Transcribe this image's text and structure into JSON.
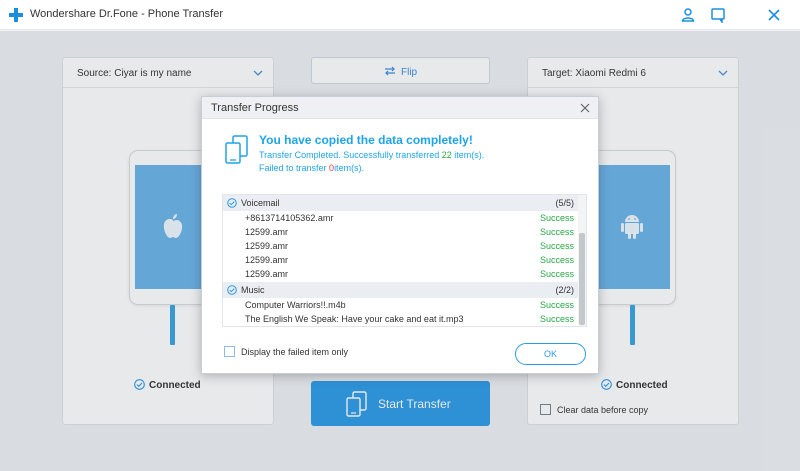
{
  "window": {
    "title": "Wondershare Dr.Fone - Phone Transfer",
    "icons": [
      "account-icon",
      "feedback-icon",
      "close-icon"
    ]
  },
  "source": {
    "label": "Source: Ciyar is my name",
    "status": "Connected",
    "device_icon": "apple-icon"
  },
  "target": {
    "label": "Target: Xiaomi Redmi 6",
    "status": "Connected",
    "device_icon": "android-icon"
  },
  "flip_label": "Flip",
  "start_transfer_label": "Start Transfer",
  "clear_data_label": "Clear data before copy",
  "dialog": {
    "title": "Transfer Progress",
    "summary_title": "You have copied the data completely!",
    "line1_prefix": "Transfer Completed.  Successfully transferred",
    "transferred_count": "22",
    "line1_suffix": "item(s).",
    "line2_prefix": "Failed to transfer",
    "failed_count": "0",
    "line2_suffix": "item(s).",
    "categories": [
      {
        "name": "Voicemail",
        "count": "(5/5)",
        "items": [
          {
            "file": "+8613714105362.amr",
            "status": "Success"
          },
          {
            "file": "12599.amr",
            "status": "Success"
          },
          {
            "file": "12599.amr",
            "status": "Success"
          },
          {
            "file": "12599.amr",
            "status": "Success"
          },
          {
            "file": "12599.amr",
            "status": "Success"
          }
        ]
      },
      {
        "name": "Music",
        "count": "(2/2)",
        "items": [
          {
            "file": "Computer Warriors!!.m4b",
            "status": "Success"
          },
          {
            "file": "The English We Speak: Have your cake and eat it.mp3",
            "status": "Success"
          }
        ]
      }
    ],
    "display_failed_label": "Display the failed item only",
    "ok_label": "OK"
  },
  "colors": {
    "accent": "#2d9ae8",
    "success": "#28a745",
    "error": "#e53935",
    "info_text": "#1ea4e8"
  }
}
